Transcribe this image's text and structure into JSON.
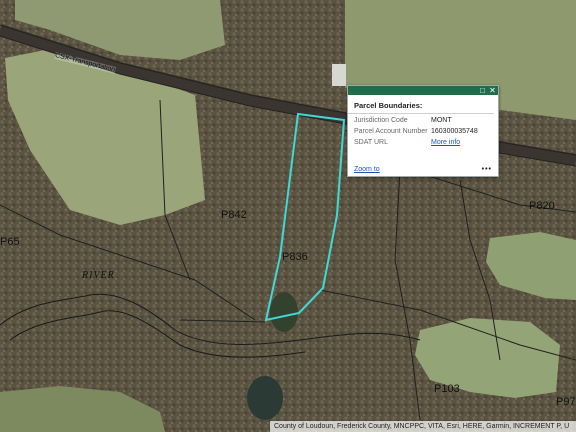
{
  "map": {
    "railroad_label": "CSX-Transportation",
    "river_label": "RIVER",
    "parcel_labels": [
      "P842",
      "P836",
      "P820",
      "P65",
      "P103",
      "P97"
    ],
    "highlight_color": "#3fd9d6"
  },
  "popup": {
    "title": "Parcel Boundaries:",
    "rows": [
      {
        "key": "Jurisdiction Code",
        "value": "MONT"
      },
      {
        "key": "Parcel Account Number",
        "value": "160300035748"
      },
      {
        "key": "SDAT URL",
        "value": "More info"
      }
    ],
    "zoom_label": "Zoom to",
    "more_label": "•••",
    "maximize_icon": "maximize-icon",
    "close_icon": "close-icon"
  },
  "attribution": "County of Loudoun, Frederick County, MNCPPC, VITA, Esri, HERE, Garmin, INCREMENT P, U"
}
